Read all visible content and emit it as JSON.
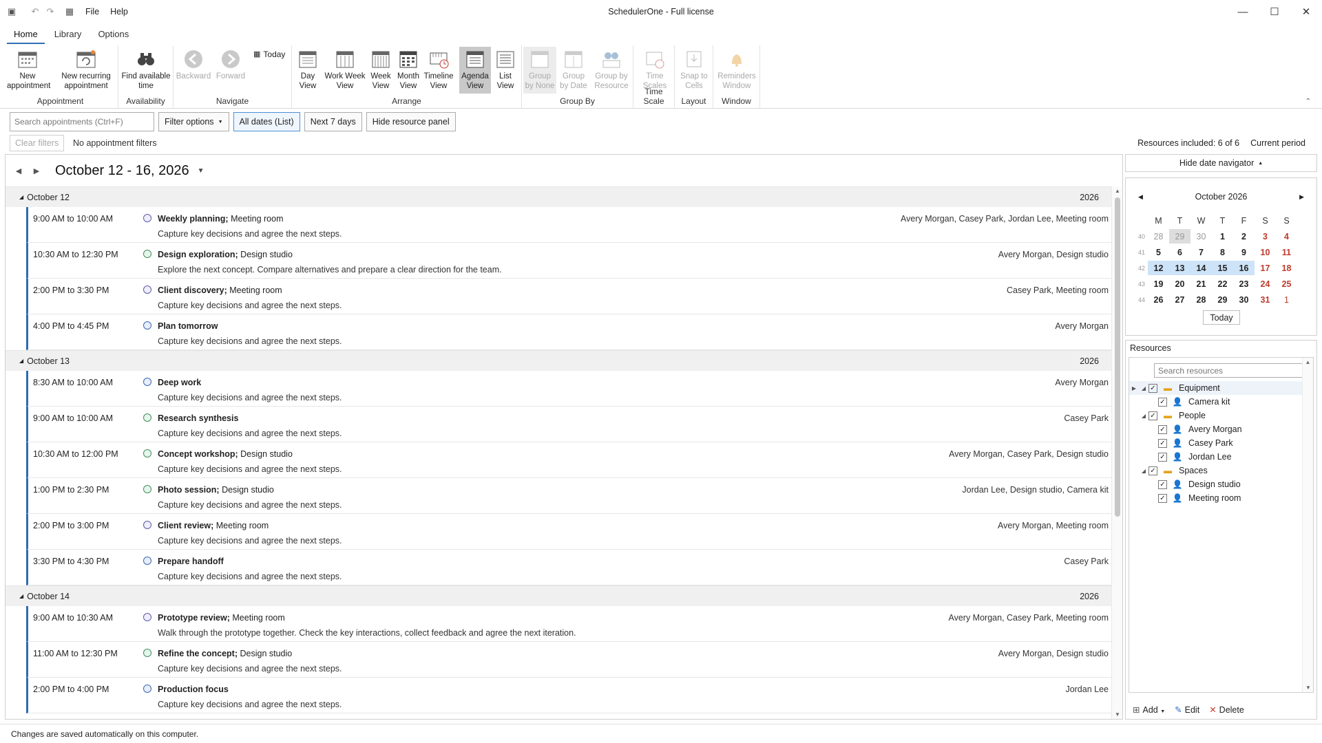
{
  "app": {
    "title": "SchedulerOne - Full license",
    "menu": [
      "File",
      "Help"
    ]
  },
  "ribbon": {
    "tabs": [
      {
        "label": "Home",
        "active": true
      },
      {
        "label": "Library",
        "active": false
      },
      {
        "label": "Options",
        "active": false
      }
    ],
    "groups": {
      "appointment": {
        "label": "Appointment",
        "new": "New appointment",
        "new_recurring": "New recurring appointment"
      },
      "availability": {
        "label": "Availability",
        "find": "Find available time"
      },
      "navigate": {
        "label": "Navigate",
        "backward": "Backward",
        "forward": "Forward",
        "today": "Today"
      },
      "arrange": {
        "label": "Arrange",
        "day": "Day View",
        "work_week": "Work Week View",
        "week": "Week View",
        "month": "Month View",
        "timeline": "Timeline View",
        "agenda": "Agenda View",
        "list": "List View"
      },
      "group_by": {
        "label": "Group By",
        "none": "Group by None",
        "date": "Group by Date",
        "resource": "Group by Resource"
      },
      "time_scale": {
        "label": "Time Scale",
        "scales": "Time Scales"
      },
      "layout": {
        "label": "Layout",
        "snap": "Snap to Cells"
      },
      "window": {
        "label": "Window",
        "reminders": "Reminders Window"
      }
    }
  },
  "toolbar": {
    "search_placeholder": "Search appointments (Ctrl+F)",
    "filter_options": "Filter options",
    "all_dates": "All dates (List)",
    "next_7_days": "Next 7 days",
    "hide_resource_panel": "Hide resource panel",
    "clear_filters": "Clear filters",
    "no_filters": "No appointment filters",
    "resources_included": "Resources included: 6 of 6",
    "current_period": "Current period"
  },
  "agenda": {
    "range_title": "October 12 - 16, 2026",
    "days": [
      {
        "label": "October 12",
        "year": "2026",
        "appointments": [
          {
            "time": "9:00 AM to 10:00 AM",
            "subject": "Weekly planning;",
            "location": "Meeting room",
            "desc": "Capture key decisions and agree the next steps.",
            "resources": "Avery Morgan, Casey Park, Jordan Lee, Meeting room",
            "status": "purple"
          },
          {
            "time": "10:30 AM to 12:30 PM",
            "subject": "Design exploration;",
            "location": "Design studio",
            "desc": "Explore the next concept. Compare alternatives and prepare a clear direction for the team.",
            "resources": "Avery Morgan, Design studio",
            "status": "green"
          },
          {
            "time": "2:00 PM to 3:30 PM",
            "subject": "Client discovery;",
            "location": "Meeting room",
            "desc": "Capture key decisions and agree the next steps.",
            "resources": "Casey Park, Meeting room",
            "status": "purple"
          },
          {
            "time": "4:00 PM to 4:45 PM",
            "subject": "Plan tomorrow",
            "location": "",
            "desc": "Capture key decisions and agree the next steps.",
            "resources": "Avery Morgan",
            "status": "blue"
          }
        ]
      },
      {
        "label": "October 13",
        "year": "2026",
        "appointments": [
          {
            "time": "8:30 AM to 10:00 AM",
            "subject": "Deep work",
            "location": "",
            "desc": "Capture key decisions and agree the next steps.",
            "resources": "Avery Morgan",
            "status": "blue"
          },
          {
            "time": "9:00 AM to 10:00 AM",
            "subject": "Research synthesis",
            "location": "",
            "desc": "Capture key decisions and agree the next steps.",
            "resources": "Casey Park",
            "status": "green"
          },
          {
            "time": "10:30 AM to 12:00 PM",
            "subject": "Concept workshop;",
            "location": "Design studio",
            "desc": "Capture key decisions and agree the next steps.",
            "resources": "Avery Morgan, Casey Park, Design studio",
            "status": "green"
          },
          {
            "time": "1:00 PM to 2:30 PM",
            "subject": "Photo session;",
            "location": "Design studio",
            "desc": "Capture key decisions and agree the next steps.",
            "resources": "Jordan Lee, Design studio, Camera kit",
            "status": "green"
          },
          {
            "time": "2:00 PM to 3:00 PM",
            "subject": "Client review;",
            "location": "Meeting room",
            "desc": "Capture key decisions and agree the next steps.",
            "resources": "Avery Morgan, Meeting room",
            "status": "purple"
          },
          {
            "time": "3:30 PM to 4:30 PM",
            "subject": "Prepare handoff",
            "location": "",
            "desc": "Capture key decisions and agree the next steps.",
            "resources": "Casey Park",
            "status": "blue"
          }
        ]
      },
      {
        "label": "October 14",
        "year": "2026",
        "appointments": [
          {
            "time": "9:00 AM to 10:30 AM",
            "subject": "Prototype review;",
            "location": "Meeting room",
            "desc": "Walk through the prototype together. Check the key interactions, collect feedback and agree the next iteration.",
            "resources": "Avery Morgan, Casey Park, Meeting room",
            "status": "purple"
          },
          {
            "time": "11:00 AM to 12:30 PM",
            "subject": "Refine the concept;",
            "location": "Design studio",
            "desc": "Capture key decisions and agree the next steps.",
            "resources": "Avery Morgan, Design studio",
            "status": "green"
          },
          {
            "time": "2:00 PM to 4:00 PM",
            "subject": "Production focus",
            "location": "",
            "desc": "Capture key decisions and agree the next steps.",
            "resources": "Jordan Lee",
            "status": "blue"
          }
        ]
      }
    ]
  },
  "date_navigator": {
    "toggle": "Hide date navigator",
    "month": "October 2026",
    "weekday_headers": [
      "M",
      "T",
      "W",
      "T",
      "F",
      "S",
      "S"
    ],
    "weeks": [
      {
        "wk": "40",
        "days": [
          "28",
          "29",
          "30",
          "1",
          "2",
          "3",
          "4"
        ]
      },
      {
        "wk": "41",
        "days": [
          "5",
          "6",
          "7",
          "8",
          "9",
          "10",
          "11"
        ]
      },
      {
        "wk": "42",
        "days": [
          "12",
          "13",
          "14",
          "15",
          "16",
          "17",
          "18"
        ]
      },
      {
        "wk": "43",
        "days": [
          "19",
          "20",
          "21",
          "22",
          "23",
          "24",
          "25"
        ]
      },
      {
        "wk": "44",
        "days": [
          "26",
          "27",
          "28",
          "29",
          "30",
          "31",
          "1"
        ]
      }
    ],
    "today_button": "Today"
  },
  "resources": {
    "title": "Resources",
    "search_placeholder": "Search resources",
    "tree": [
      {
        "label": "Equipment",
        "type": "group",
        "level": 0
      },
      {
        "label": "Camera kit",
        "type": "item",
        "level": 1
      },
      {
        "label": "People",
        "type": "group",
        "level": 0
      },
      {
        "label": "Avery Morgan",
        "type": "item",
        "level": 1
      },
      {
        "label": "Casey Park",
        "type": "item",
        "level": 1
      },
      {
        "label": "Jordan Lee",
        "type": "item",
        "level": 1
      },
      {
        "label": "Spaces",
        "type": "group",
        "level": 0
      },
      {
        "label": "Design studio",
        "type": "item",
        "level": 1
      },
      {
        "label": "Meeting room",
        "type": "item",
        "level": 1
      }
    ],
    "actions": {
      "add": "Add",
      "edit": "Edit",
      "delete": "Delete"
    }
  },
  "status_bar": "Changes are saved automatically on this computer.",
  "colors": {
    "accent": "#2f6fb7",
    "selected_range": "#cde3f7",
    "weekend": "#c0392b"
  }
}
